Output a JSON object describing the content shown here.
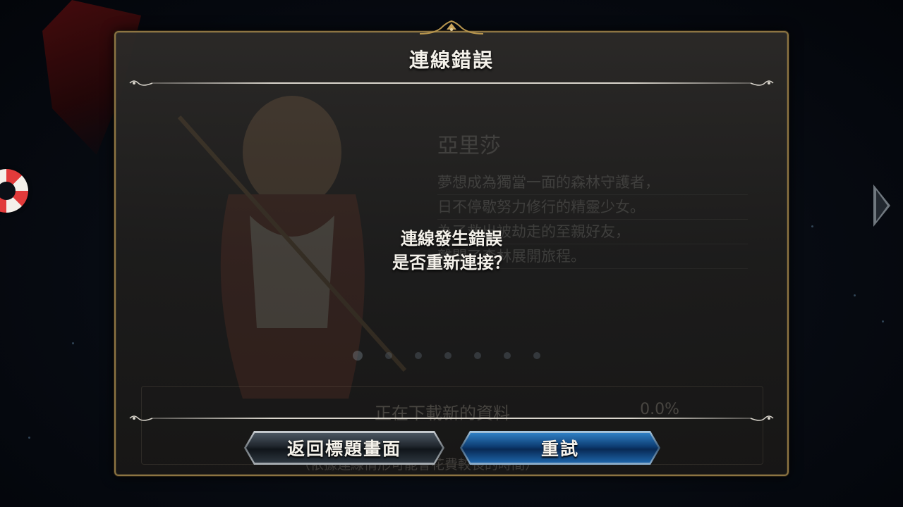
{
  "dialog": {
    "title": "連線錯誤",
    "message_line1": "連線發生錯誤",
    "message_line2": "是否重新連接？",
    "buttons": {
      "back_to_title": "返回標題畫面",
      "retry": "重試"
    }
  },
  "background": {
    "character_name": "亞里莎",
    "description": [
      "夢想成為獨當一面的森林守護者，",
      "日不停歇努力修行的精靈少女。",
      "為了救出被劫走的至親好友，",
      "離開了森林展開旅程。"
    ],
    "download_status": "正在下載新的資料",
    "download_percent": "0.0%",
    "note": "（依據連線情形可能會花費較長的時間）"
  },
  "colors": {
    "dialog_border": "#8d7442",
    "title_text": "#f4f1ea",
    "retry_button": "#1d64a8",
    "back_button": "#2d363f"
  },
  "icons": {
    "help": "lifebuoy-icon",
    "next": "next-arrow-icon"
  }
}
